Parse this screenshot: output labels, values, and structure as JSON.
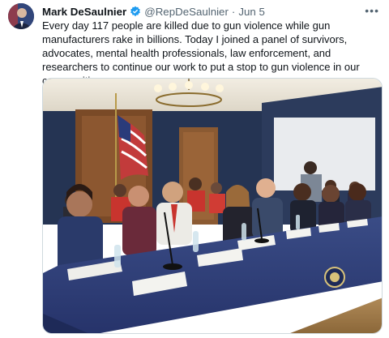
{
  "tweet": {
    "author_name": "Mark DeSaulnier",
    "handle": "@RepDeSaulnier",
    "separator": "·",
    "date": "Jun 5",
    "more_label": "•••",
    "text": "Every day 117 people are killed due to gun violence while gun manufacturers rake in billions. Today I joined a panel of survivors, advocates, mental health professionals, law enforcement, and researchers to continue our work to put a stop to gun violence in our communities."
  },
  "photo": {
    "icons": [
      "us-flag-icon",
      "capitol-seal-icon",
      "chandelier-icon"
    ]
  },
  "colors": {
    "verified_blue": "#1d9bf0",
    "wall_navy": "#253453",
    "tablecloth": "#2f3f74"
  }
}
